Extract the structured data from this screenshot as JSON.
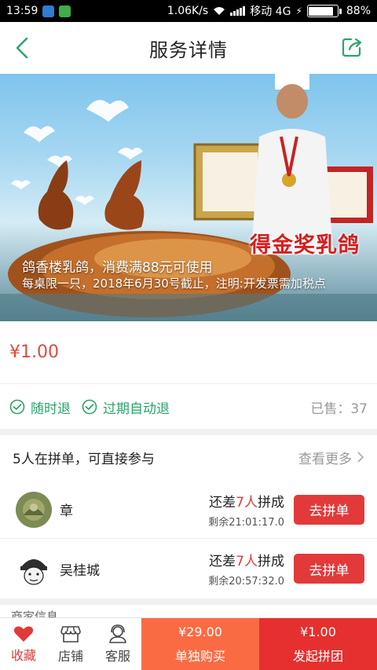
{
  "status_bar": {
    "time": "13:59",
    "network_speed": "1.06K/s",
    "carrier": "移动 4G",
    "battery": "88%",
    "battery_level": 0.88
  },
  "nav": {
    "title": "服务详情",
    "back_icon": "chevron-left-icon",
    "share_icon": "share-icon"
  },
  "banner": {
    "caption_line1": "鸽香楼乳鸽，消费满88元可使用",
    "caption_line2": "每桌限一只，2018年6月30号截止，注明:开发票需加税点",
    "award_text": "得金奖乳鸽"
  },
  "price": "¥1.00",
  "guarantees": [
    {
      "label": "随时退",
      "icon": "check-circle-icon"
    },
    {
      "label": "过期自动退",
      "icon": "check-circle-icon"
    }
  ],
  "sold": "已售：37",
  "group": {
    "heading": "5人在拼单，可直接参与",
    "more_label": "查看更多",
    "members": [
      {
        "name": "章",
        "status_prefix": "还差",
        "status_count": "7人",
        "status_suffix": "拼成",
        "remaining": "剩余21:01:17.0",
        "button": "去拼单"
      },
      {
        "name": "吴桂城",
        "status_prefix": "还差",
        "status_count": "7人",
        "status_suffix": "拼成",
        "remaining": "剩余20:57:32.0",
        "button": "去拼单"
      }
    ]
  },
  "merchant_heading": "商家信息",
  "bottom_bar": {
    "favorite": "收藏",
    "store": "店铺",
    "service": "客服",
    "solo_price": "¥29.00",
    "solo_label": "单独购买",
    "group_price": "¥1.00",
    "group_label": "发起拼团"
  },
  "colors": {
    "accent_green": "#2aa56b",
    "price_red": "#e04a3f",
    "button_red": "#e23a3a",
    "solo_orange": "#fb6b43"
  }
}
